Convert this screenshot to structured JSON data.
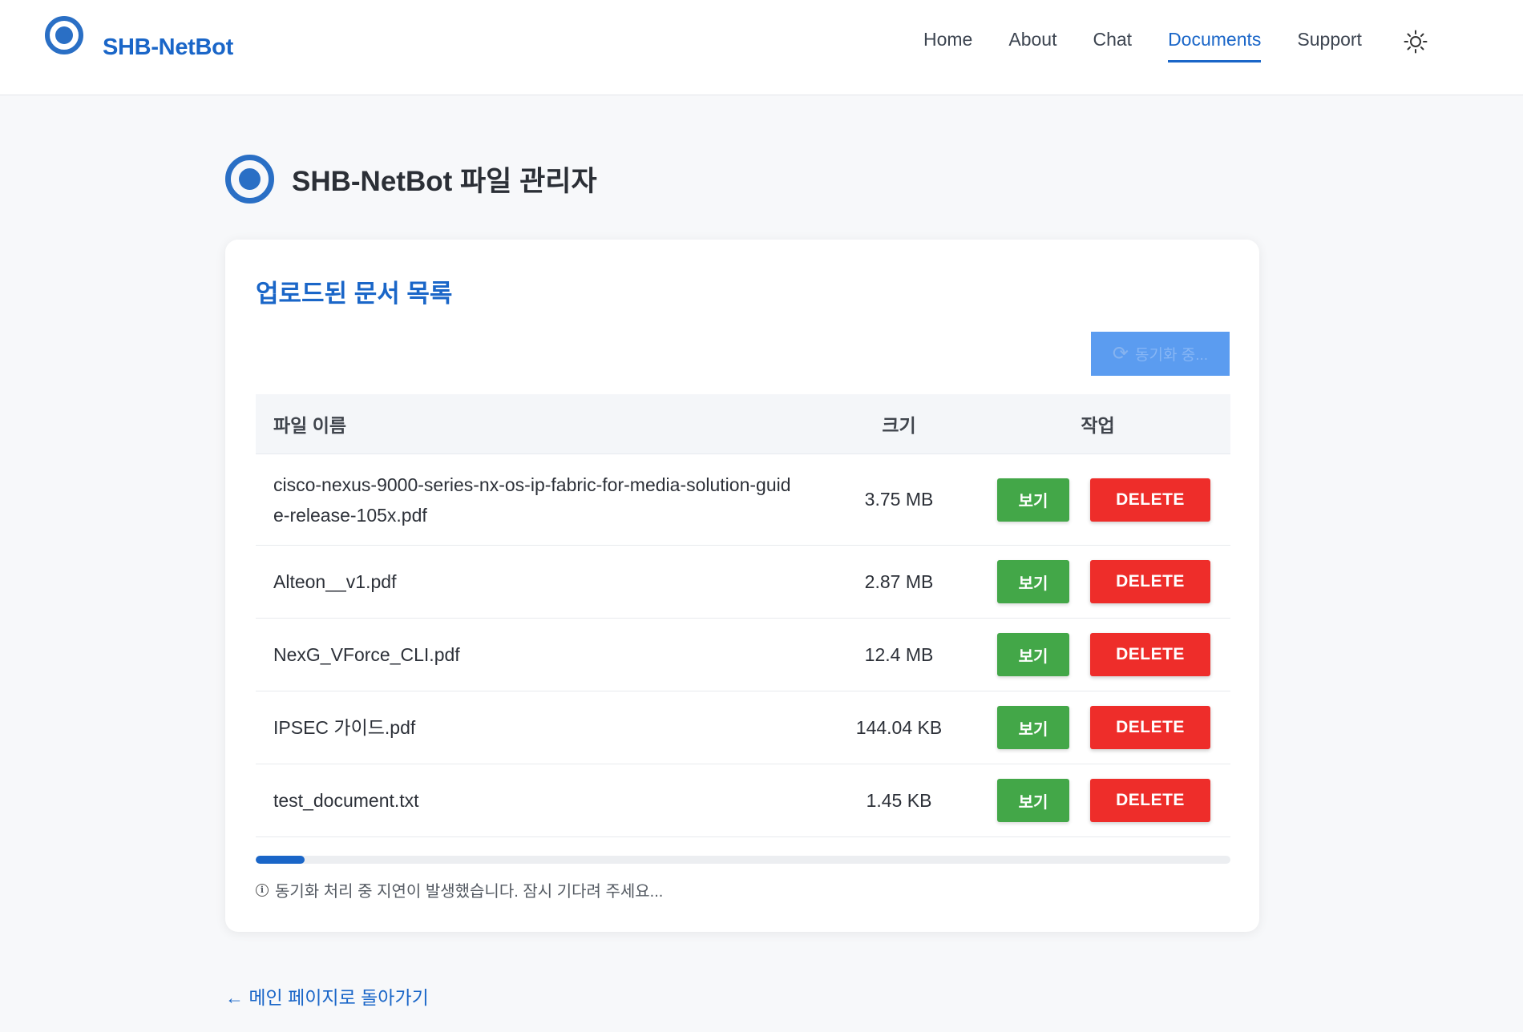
{
  "brand": {
    "name": "SHB-NetBot"
  },
  "nav": {
    "items": [
      {
        "label": "Home",
        "active": false
      },
      {
        "label": "About",
        "active": false
      },
      {
        "label": "Chat",
        "active": false
      },
      {
        "label": "Documents",
        "active": true
      },
      {
        "label": "Support",
        "active": false
      }
    ],
    "theme_icon": "sun-icon"
  },
  "page": {
    "title": "SHB-NetBot 파일 관리자"
  },
  "card": {
    "title": "업로드된 문서 목록",
    "sync_button": {
      "label": "동기화 중...",
      "icon": "refresh-icon",
      "disabled": true
    }
  },
  "table": {
    "headers": {
      "name": "파일 이름",
      "size": "크기",
      "actions": "작업"
    },
    "rows": [
      {
        "name": "cisco-nexus-9000-series-nx-os-ip-fabric-for-media-solution-guide-release-105x.pdf",
        "size": "3.75 MB",
        "view": "보기",
        "delete": "DELETE"
      },
      {
        "name": "Alteon__v1.pdf",
        "size": "2.87 MB",
        "view": "보기",
        "delete": "DELETE"
      },
      {
        "name": "NexG_VForce_CLI.pdf",
        "size": "12.4 MB",
        "view": "보기",
        "delete": "DELETE"
      },
      {
        "name": "IPSEC 가이드.pdf",
        "size": "144.04 KB",
        "view": "보기",
        "delete": "DELETE"
      },
      {
        "name": "test_document.txt",
        "size": "1.45 KB",
        "view": "보기",
        "delete": "DELETE"
      }
    ]
  },
  "progress": {
    "fraction": 0.05,
    "note": "동기화 처리 중 지연이 발생했습니다. 잠시 기다려 주세요...",
    "icon": "info-icon"
  },
  "back_link": {
    "label": "← 메인 페이지로 돌아가기"
  },
  "colors": {
    "brand_blue": "#1a66c8",
    "view_green": "#43a748",
    "delete_red": "#ee2d2a",
    "sync_blue": "#5b9cf0"
  }
}
